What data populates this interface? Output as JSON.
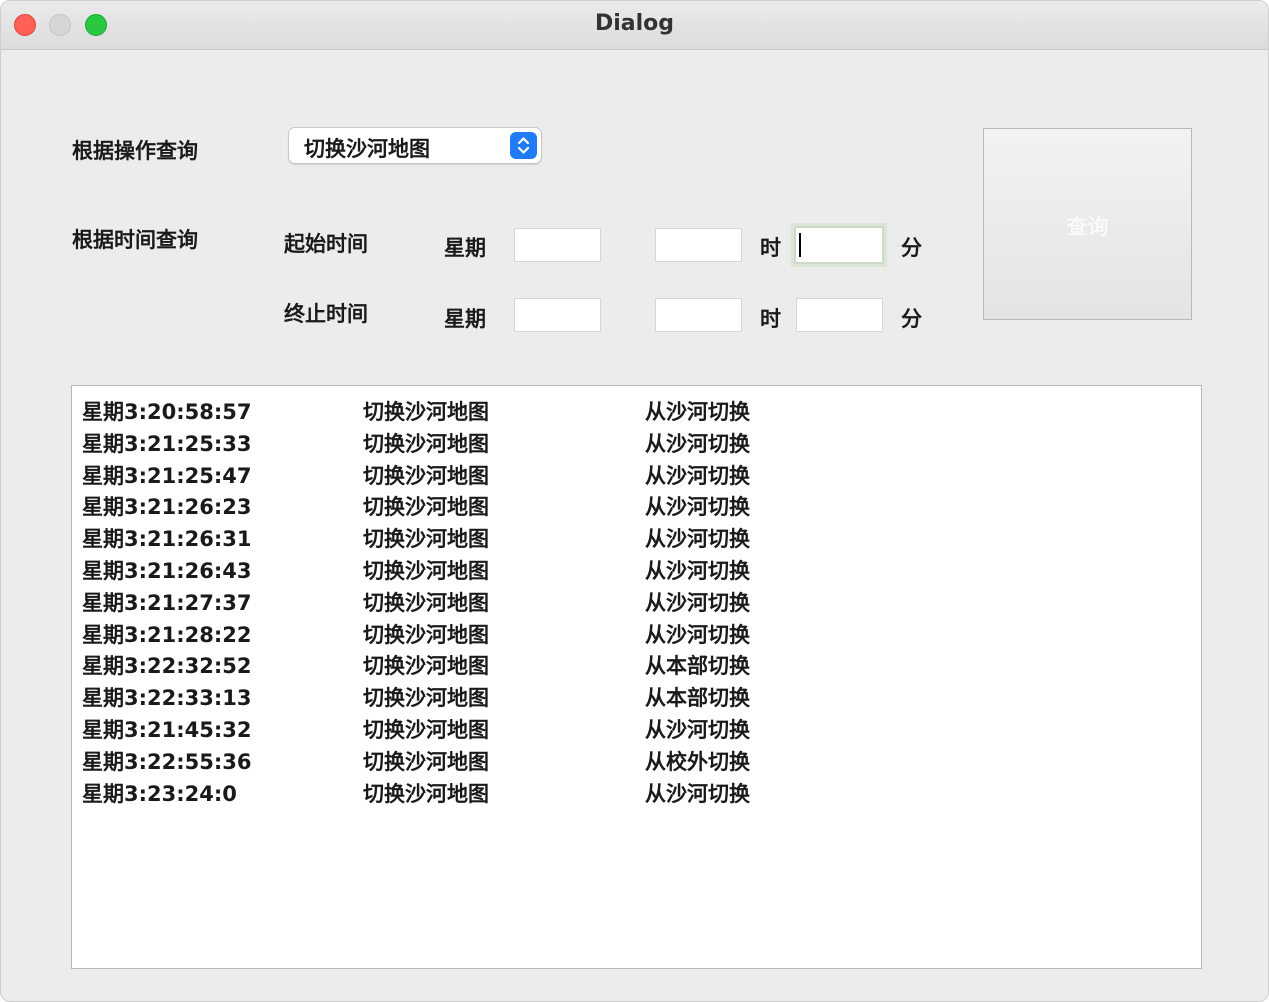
{
  "window": {
    "title": "Dialog"
  },
  "operation_query": {
    "label": "根据操作查询",
    "selected": "切换沙河地图"
  },
  "time_query": {
    "label": "根据时间查询",
    "start": {
      "label": "起始时间",
      "weekday_label": "星期",
      "hour_unit": "时",
      "minute_unit": "分",
      "weekday": "",
      "hour": "",
      "minute": ""
    },
    "end": {
      "label": "终止时间",
      "weekday_label": "星期",
      "hour_unit": "时",
      "minute_unit": "分",
      "weekday": "",
      "hour": "",
      "minute": ""
    }
  },
  "query_button": {
    "label": "查询"
  },
  "results": [
    [
      "星期3:20:58:57",
      "切换沙河地图",
      "从沙河切换"
    ],
    [
      "星期3:21:25:33",
      "切换沙河地图",
      "从沙河切换"
    ],
    [
      "星期3:21:25:47",
      "切换沙河地图",
      "从沙河切换"
    ],
    [
      "星期3:21:26:23",
      "切换沙河地图",
      "从沙河切换"
    ],
    [
      "星期3:21:26:31",
      "切换沙河地图",
      "从沙河切换"
    ],
    [
      "星期3:21:26:43",
      "切换沙河地图",
      "从沙河切换"
    ],
    [
      "星期3:21:27:37",
      "切换沙河地图",
      "从沙河切换"
    ],
    [
      "星期3:21:28:22",
      "切换沙河地图",
      "从沙河切换"
    ],
    [
      "星期3:22:32:52",
      "切换沙河地图",
      "从本部切换"
    ],
    [
      "星期3:22:33:13",
      "切换沙河地图",
      "从本部切换"
    ],
    [
      "星期3:21:45:32",
      "切换沙河地图",
      "从沙河切换"
    ],
    [
      "星期3:22:55:36",
      "切换沙河地图",
      "从校外切换"
    ],
    [
      "星期3:23:24:0",
      "切换沙河地图",
      "从沙河切换"
    ]
  ]
}
